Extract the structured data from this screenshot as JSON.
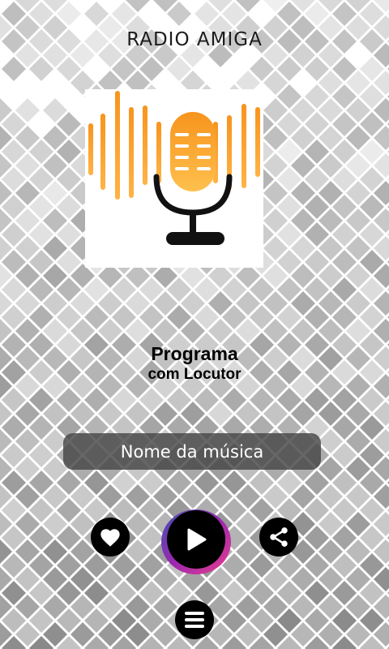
{
  "app": {
    "title": "RADIO AMIGA"
  },
  "program": {
    "line1": "Programa",
    "line2": "com Locutor"
  },
  "song": {
    "label": "Nome da música"
  },
  "controls": {
    "favorite_icon": "heart-icon",
    "play_icon": "play-icon",
    "share_icon": "share-icon",
    "menu_icon": "menu-icon"
  },
  "colors": {
    "accent_orange": "#f7941d",
    "accent_light": "#ffc04d",
    "button": "#000000",
    "song_bar": "#464646",
    "play_glow_pink": "#e83e8c",
    "play_glow_blue": "#3f51b5"
  }
}
